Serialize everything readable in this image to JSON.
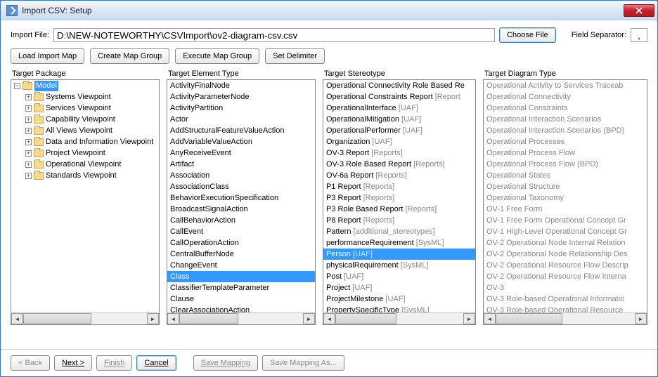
{
  "window": {
    "title": "Import CSV: Setup"
  },
  "importFile": {
    "label": "Import File:",
    "value": "D:\\NEW-NOTEWORTHY\\CSVImport\\ov2-diagram-csv.csv",
    "choose": "Choose File",
    "separatorLabel": "Field Separator:",
    "separatorValue": ","
  },
  "toolbar": {
    "loadMap": "Load Import Map",
    "createGroup": "Create Map Group",
    "executeGroup": "Execute Map Group",
    "setDelimiter": "Set Delimiter"
  },
  "columns": {
    "package": {
      "header": "Target Package",
      "items": [
        {
          "label": "Model",
          "depth": 0,
          "expanded": true,
          "selected": true
        },
        {
          "label": "Systems Viewpoint",
          "depth": 1,
          "expandable": true
        },
        {
          "label": "Services Viewpoint",
          "depth": 1,
          "expandable": true
        },
        {
          "label": "Capability Viewpoint",
          "depth": 1,
          "expandable": true
        },
        {
          "label": "All Views Viewpoint",
          "depth": 1,
          "expandable": true
        },
        {
          "label": "Data and Information Viewpoint",
          "depth": 1,
          "expandable": true
        },
        {
          "label": "Project Viewpoint",
          "depth": 1,
          "expandable": true
        },
        {
          "label": "Operational Viewpoint",
          "depth": 1,
          "expandable": true
        },
        {
          "label": "Standards Viewpoint",
          "depth": 1,
          "expandable": true
        }
      ]
    },
    "elementType": {
      "header": "Target Element Type",
      "items": [
        {
          "label": "ActivityFinalNode"
        },
        {
          "label": "ActivityParameterNode"
        },
        {
          "label": "ActivityPartition"
        },
        {
          "label": "Actor"
        },
        {
          "label": "AddStructuralFeatureValueAction"
        },
        {
          "label": "AddVariableValueAction"
        },
        {
          "label": "AnyReceiveEvent"
        },
        {
          "label": "Artifact"
        },
        {
          "label": "Association"
        },
        {
          "label": "AssociationClass"
        },
        {
          "label": "BehaviorExecutionSpecification"
        },
        {
          "label": "BroadcastSignalAction"
        },
        {
          "label": "CallBehaviorAction"
        },
        {
          "label": "CallEvent"
        },
        {
          "label": "CallOperationAction"
        },
        {
          "label": "CentralBufferNode"
        },
        {
          "label": "ChangeEvent"
        },
        {
          "label": "Class",
          "selected": true
        },
        {
          "label": "ClassifierTemplateParameter"
        },
        {
          "label": "Clause"
        },
        {
          "label": "ClearAssociationAction"
        }
      ]
    },
    "stereotype": {
      "header": "Target Stereotype",
      "items": [
        {
          "label": "Operational Connectivity Role Based Re"
        },
        {
          "label": "Operational Constraints Report",
          "qual": "[Report"
        },
        {
          "label": "OperationalInterface",
          "qual": "[UAF]"
        },
        {
          "label": "OperationalMitigation",
          "qual": "[UAF]"
        },
        {
          "label": "OperationalPerformer",
          "qual": "[UAF]"
        },
        {
          "label": "Organization",
          "qual": "[UAF]"
        },
        {
          "label": "OV-3 Report",
          "qual": "[Reports]"
        },
        {
          "label": "OV-3 Role Based Report",
          "qual": "[Reports]"
        },
        {
          "label": "OV-6a Report",
          "qual": "[Reports]"
        },
        {
          "label": "P1 Report",
          "qual": "[Reports]"
        },
        {
          "label": "P3 Report",
          "qual": "[Reports]"
        },
        {
          "label": "P3 Role Based Report",
          "qual": "[Reports]"
        },
        {
          "label": "P8 Report",
          "qual": "[Reports]"
        },
        {
          "label": "Pattern",
          "qual": "[additional_stereotypes]"
        },
        {
          "label": "performanceRequirement",
          "qual": "[SysML]"
        },
        {
          "label": "Person",
          "qual": "[UAF]",
          "selected": true
        },
        {
          "label": "physicalRequirement",
          "qual": "[SysML]"
        },
        {
          "label": "Post",
          "qual": "[UAF]"
        },
        {
          "label": "Project",
          "qual": "[UAF]"
        },
        {
          "label": "ProjectMilestone",
          "qual": "[UAF]"
        },
        {
          "label": "PropertySpecificType",
          "qual": "[SysML]"
        }
      ]
    },
    "diagramType": {
      "header": "Target Diagram Type",
      "items": [
        {
          "label": "Operational Activity to Services Traceab"
        },
        {
          "label": "Operational Connectivity"
        },
        {
          "label": "Operational Constraints"
        },
        {
          "label": "Operational Interaction Scenarios"
        },
        {
          "label": "Operational Interaction Scenarios (BPD)"
        },
        {
          "label": "Operational Processes"
        },
        {
          "label": "Operational Process Flow"
        },
        {
          "label": "Operational Process Flow (BPD)"
        },
        {
          "label": "Operational States"
        },
        {
          "label": "Operational Structure"
        },
        {
          "label": "Operational Taxonomy"
        },
        {
          "label": "OV-1 Free Form"
        },
        {
          "label": "OV-1 Free Form Operational Concept Gr"
        },
        {
          "label": "OV-1 High-Level Operational Concept Gr"
        },
        {
          "label": "OV-2 Operational Node Internal Relation"
        },
        {
          "label": "OV-2 Operational Node Relationship Des"
        },
        {
          "label": "OV-2 Operational Resource Flow Descrip"
        },
        {
          "label": "OV-2 Operational Resource Flow Interna"
        },
        {
          "label": "OV-3"
        },
        {
          "label": "OV-3 Role-based Operational Informatio"
        },
        {
          "label": "OV-3 Role-based Operational Resource"
        }
      ]
    }
  },
  "footer": {
    "back": "< Back",
    "next": "Next >",
    "finish": "Finish",
    "cancel": "Cancel",
    "saveMapping": "Save Mapping",
    "saveMappingAs": "Save Mapping As..."
  }
}
